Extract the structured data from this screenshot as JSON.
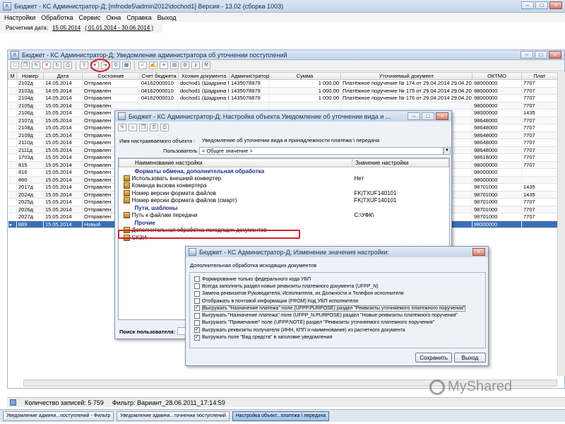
{
  "app": {
    "title": "Бюджет - КС Администратор-Д; [mfnode5\\admin2012\\dochod1] Версия - 13.02 (сборка 1003)",
    "menu": [
      "Настройки",
      "Обработка",
      "Сервис",
      "Окна",
      "Справка",
      "Выход"
    ],
    "calc_date_label": "Расчетная дата:",
    "calc_date": "15.05.2014",
    "period": "( 01.01.2014 - 30.06.2014 )"
  },
  "doc_window": {
    "title": "Бюджет - КС Администратор-Д; Уведомление администратора об уточнении поступлений",
    "columns": [
      "М",
      "Номер",
      "Дата",
      "Состояние",
      "Счет бюджета",
      "Хозяин документа",
      "Администратор",
      "Сумма",
      "Уточняемый документ",
      "ОКТМО",
      "Плат"
    ],
    "rows": [
      [
        "",
        "2102д",
        "14.05.2014",
        "Отправлен",
        "04162000010",
        "dochod1 (Шадрина М",
        "1435078879",
        "1 000.00",
        "Платёжное поручение № 174 от 29.04.2014 29.04.2014",
        "98000000",
        "7707"
      ],
      [
        "",
        "2103д",
        "14.05.2014",
        "Отправлен",
        "04162000010",
        "dochod1 (Шадрина М",
        "1435078879",
        "1 000.00",
        "Платёжное поручение № 175 от 29.04.2014 29.04.2014",
        "98000000",
        "7707"
      ],
      [
        "",
        "2104д",
        "14.05.2014",
        "Отправлен",
        "04162000010",
        "dochod1 (Шадрина М",
        "1435078879",
        "1 000.00",
        "Платёжное поручение № 176 от 29.04.2014 29.04.2014",
        "98000000",
        "7707"
      ],
      [
        "",
        "2105д",
        "15.05.2014",
        "Отправлен",
        "",
        "",
        "",
        "",
        "",
        "98000000",
        "7707"
      ],
      [
        "",
        "2106д",
        "15.05.2014",
        "Отправлен",
        "",
        "",
        "",
        "",
        "",
        "98000000",
        "1435"
      ],
      [
        "",
        "2107д",
        "15.05.2014",
        "Отправлен",
        "",
        "",
        "",
        "",
        "",
        "98648000",
        "7707"
      ],
      [
        "",
        "2108д",
        "15.05.2014",
        "Отправлен",
        "",
        "",
        "",
        "",
        "",
        "98648000",
        "7707"
      ],
      [
        "",
        "2109д",
        "15.05.2014",
        "Отправлен",
        "",
        "",
        "",
        "",
        "",
        "98648000",
        "7707"
      ],
      [
        "",
        "2110д",
        "15.05.2014",
        "Отправлен",
        "",
        "",
        "",
        "",
        "",
        "98648000",
        "7707"
      ],
      [
        "",
        "2111д",
        "15.05.2014",
        "Отправлен",
        "",
        "",
        "",
        "",
        "",
        "98648000",
        "7707"
      ],
      [
        "",
        "1703д",
        "15.05.2014",
        "Отправлен",
        "",
        "",
        "",
        "",
        "",
        "98618000",
        "7707"
      ],
      [
        "",
        "815",
        "15.05.2014",
        "Отправлен",
        "",
        "",
        "",
        "",
        "",
        "98000000",
        "7707"
      ],
      [
        "",
        "816",
        "15.05.2014",
        "Отправлен",
        "",
        "",
        "",
        "",
        "04.2014",
        "98000000",
        ""
      ],
      [
        "",
        "860",
        "15.05.2014",
        "Отправлен",
        "",
        "",
        "",
        "",
        "04.2014",
        "98000000",
        ""
      ],
      [
        "",
        "2017д",
        "15.05.2014",
        "Отправлен",
        "",
        "",
        "",
        "",
        "04.2014",
        "98701000",
        "1435"
      ],
      [
        "",
        "2024д",
        "15.05.2014",
        "Отправлен",
        "",
        "",
        "",
        "",
        "03.2014",
        "98701000",
        "1435"
      ],
      [
        "",
        "2025д",
        "15.05.2014",
        "Отправлен",
        "",
        "",
        "",
        "",
        "03.2014",
        "98701000",
        "7707"
      ],
      [
        "",
        "2026д",
        "15.05.2014",
        "Отправлен",
        "",
        "",
        "",
        "",
        "03.2014",
        "98701000",
        "7707"
      ],
      [
        "",
        "2027д",
        "15.05.2014",
        "Отправлен",
        "",
        "",
        "",
        "",
        "03.2014",
        "98701000",
        "7707"
      ],
      [
        "», 889",
        "889",
        "15.05.2014",
        "Новый",
        "",
        "",
        "",
        "",
        "",
        "98000000",
        ""
      ]
    ]
  },
  "settings_dialog": {
    "title": "Бюджет - КС Администратор-Д; Настройка объекта Уведомление об уточнении вида и ...",
    "object_label": "Имя настраиваемого объекта :",
    "object_value": "Уведомление об уточнении вида и принадлежности платежа \\ передача",
    "user_label": "Пользователь :",
    "user_value": "< Общее значение >",
    "col_name": "Наименование настройки",
    "col_value": "Значение настройки",
    "rows": [
      {
        "kind": "group",
        "name": "Форматы обмена, дополнительная обработка",
        "value": ""
      },
      {
        "kind": "item",
        "name": "Использовать внешний конвертер",
        "value": "Нет"
      },
      {
        "kind": "item",
        "name": "Команда вызова конвертера",
        "value": ""
      },
      {
        "kind": "item",
        "name": "Номер версии формата файлов",
        "value": "FK|TXUF140101"
      },
      {
        "kind": "item",
        "name": "Номер версии формата файлов (смарт)",
        "value": "FK|TXUF140101"
      },
      {
        "kind": "group",
        "name": "Пути, шаблоны",
        "value": ""
      },
      {
        "kind": "item",
        "name": "Путь к файлам передачи",
        "value": "C:\\УФК\\"
      },
      {
        "kind": "group",
        "name": "Прочие",
        "value": ""
      },
      {
        "kind": "item",
        "name": "Дополнительная обработка исходящих документов",
        "value": ""
      },
      {
        "kind": "item",
        "name": "СКЗИ",
        "value": ""
      }
    ],
    "search_label": "Поиск пользователя:"
  },
  "change_dialog": {
    "title": "Бюджет - КС Администратор-Д; Изменение значения настройки:",
    "heading": "Дополнительная обработка исходящих документов",
    "options": [
      {
        "label": "Формирование только федерального кода УБП",
        "checked": false
      },
      {
        "label": "Всегда заполнять раздел новые реквизиты платежного документа (UFPP_N)",
        "checked": false
      },
      {
        "label": "Замена реквизитов Руководителя, Исполнителя, их Должности и Телефон исполнителя",
        "checked": false
      },
      {
        "label": "Отображать в почтовой информации (FROM) Код УБП исполнителя",
        "checked": false
      },
      {
        "label": "Выгружать \"Назначение платежа\" поле (UFPP.PURPOSE) раздел \"Реквизиты уточняемого платежного поручения\"",
        "checked": true
      },
      {
        "label": "Выгружать \"Назначение платежа\" поле (UFPP_N.PURPOSE) раздел \"Новые реквизиты платежного поручения\"",
        "checked": false
      },
      {
        "label": "Выгружать \"Примечание\" поле (UFPP.NOTE) раздел \"Реквизиты уточняемого платежного поручения\"",
        "checked": false
      },
      {
        "label": "Выгружать реквизиты получателя (ИНН, КПП и наименование) из расчетного документа",
        "checked": true
      },
      {
        "label": "Выгружать поле \"Вид средств\" в заголовке уведомления",
        "checked": true
      }
    ],
    "save_label": "Сохранить",
    "exit_label": "Выход"
  },
  "status": {
    "records": "Количество записей: 5 759",
    "filter": "Фильтр: Вариант_28.06.2011_17:14:59"
  },
  "taskbar": [
    {
      "label": "Уведомление админи...поступлений - Фильтр",
      "active": false
    },
    {
      "label": "Уведомление админи...точнении поступлений",
      "active": false
    },
    {
      "label": "Настройка объект...платежа \\ передача",
      "active": true
    }
  ],
  "watermark": "MyShared",
  "colors": {
    "highlight_red": "#d2202a",
    "selection_blue": "#3d6fb5",
    "group_text": "#1d2e86"
  }
}
